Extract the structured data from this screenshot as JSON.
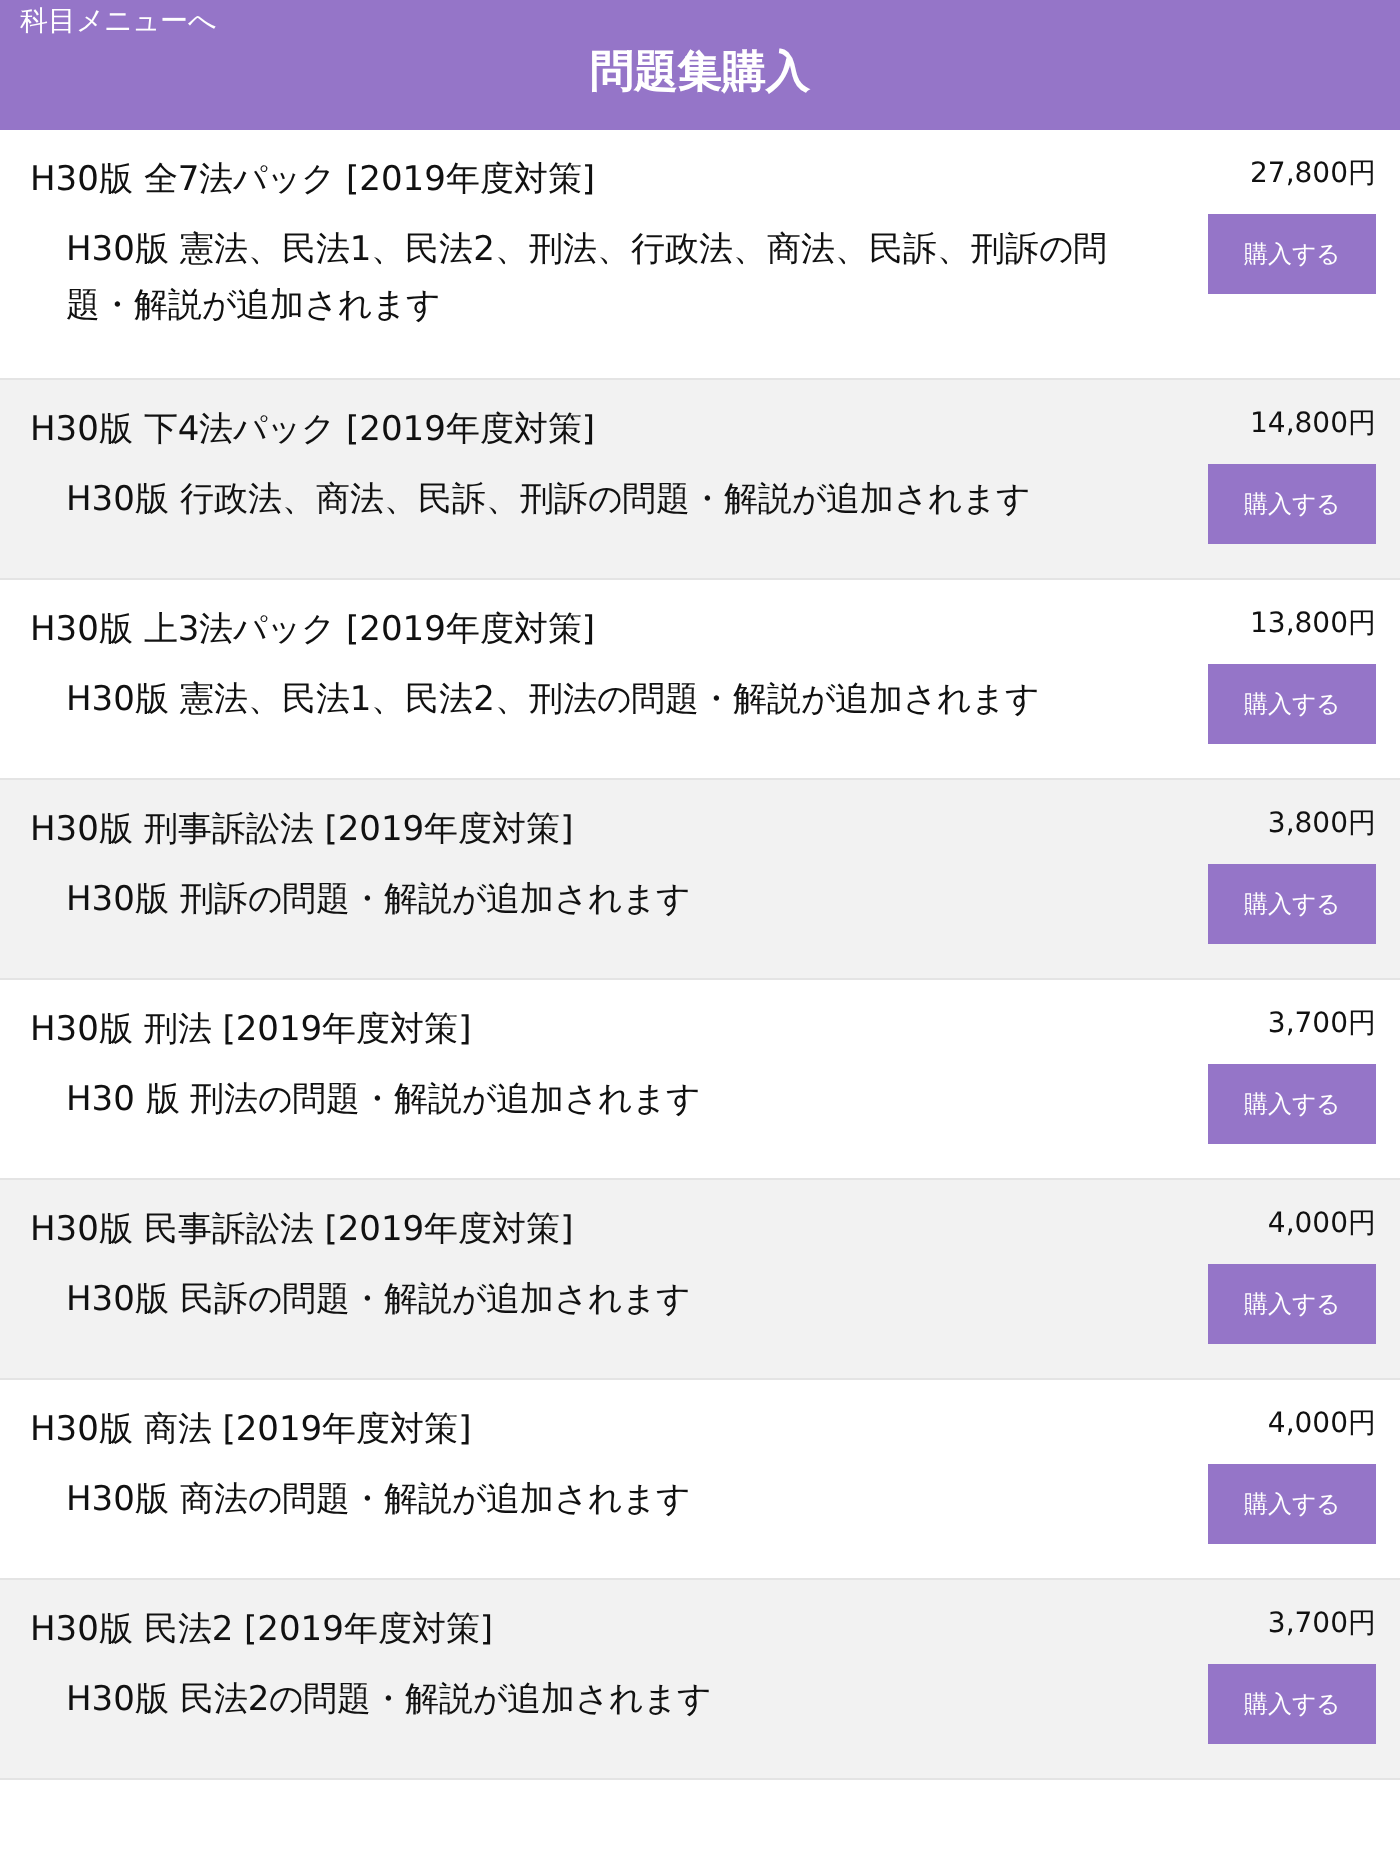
{
  "header": {
    "back_link": "科目メニューへ",
    "title": "問題集購入"
  },
  "products": [
    {
      "title": "H30版 全7法パック [2019年度対策]",
      "description": "H30版 憲法、民法1、民法2、刑法、行政法、商法、民訴、刑訴の問題・解説が追加されます",
      "price": "27,800円",
      "button": "購入する"
    },
    {
      "title": "H30版 下4法パック [2019年度対策]",
      "description": "H30版 行政法、商法、民訴、刑訴の問題・解説が追加されます",
      "price": "14,800円",
      "button": "購入する"
    },
    {
      "title": "H30版 上3法パック [2019年度対策]",
      "description": "H30版 憲法、民法1、民法2、刑法の問題・解説が追加されます",
      "price": "13,800円",
      "button": "購入する"
    },
    {
      "title": "H30版 刑事訴訟法 [2019年度対策]",
      "description": "H30版 刑訴の問題・解説が追加されます",
      "price": "3,800円",
      "button": "購入する"
    },
    {
      "title": "H30版 刑法 [2019年度対策]",
      "description": "H30 版 刑法の問題・解説が追加されます",
      "price": "3,700円",
      "button": "購入する"
    },
    {
      "title": "H30版 民事訴訟法 [2019年度対策]",
      "description": "H30版 民訴の問題・解説が追加されます",
      "price": "4,000円",
      "button": "購入する"
    },
    {
      "title": "H30版 商法 [2019年度対策]",
      "description": "H30版 商法の問題・解説が追加されます",
      "price": "4,000円",
      "button": "購入する"
    },
    {
      "title": "H30版 民法2 [2019年度対策]",
      "description": "H30版 民法2の問題・解説が追加されます",
      "price": "3,700円",
      "button": "購入する"
    }
  ]
}
